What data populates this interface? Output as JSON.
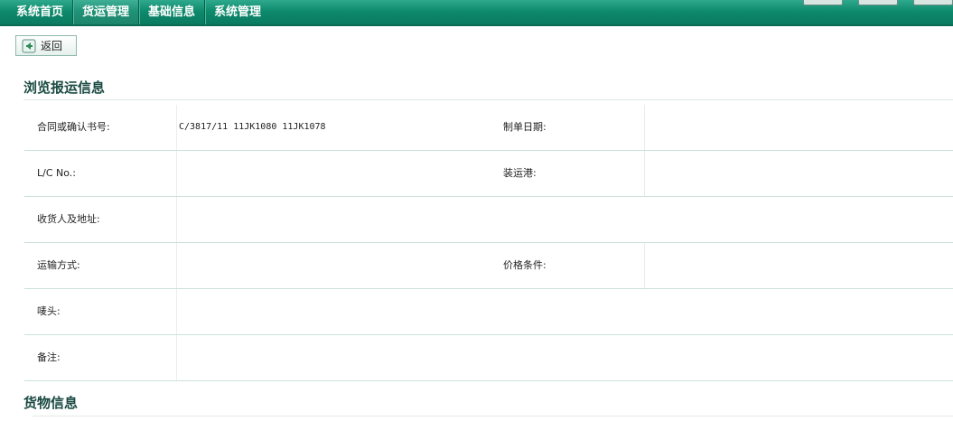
{
  "navbar": {
    "items": [
      {
        "label": "系统首页"
      },
      {
        "label": "货运管理"
      },
      {
        "label": "基础信息"
      },
      {
        "label": "系统管理"
      }
    ]
  },
  "toolbar": {
    "back_label": "返回"
  },
  "section1": {
    "title": "浏览报运信息"
  },
  "fields": {
    "contract_label": "合同或确认书号:",
    "contract_value": "C/3817/11 11JK1080 11JK1078",
    "date_label": "制单日期:",
    "lc_label": "L/C No.:",
    "port_label": "装运港:",
    "consignee_label": "收货人及地址:",
    "transport_label": "运输方式:",
    "price_label": "价格条件:",
    "marks_label": "唛头:",
    "remark_label": "备注:"
  },
  "section2": {
    "title": "货物信息"
  },
  "colors": {
    "navbar": "#0e8a6c",
    "accent_text": "#1a4a42",
    "row_border": "#cde0db"
  }
}
